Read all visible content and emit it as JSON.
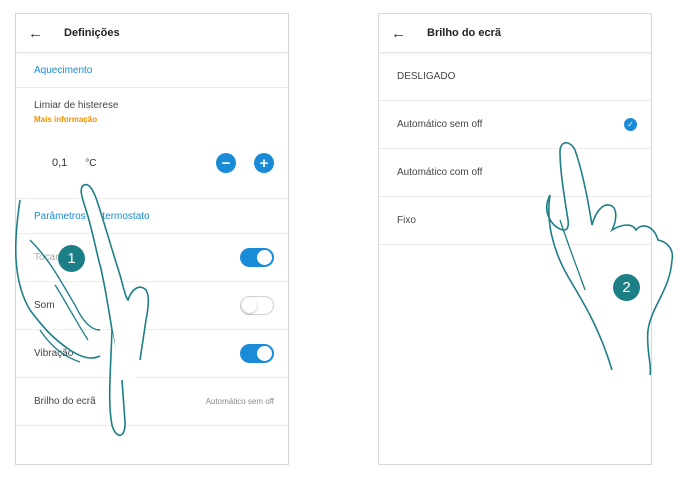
{
  "screen1": {
    "back_icon": "arrow-left-icon",
    "title": "Definições",
    "section_heating": "Aquecimento",
    "hysteresis_label": "Limiar de histerese",
    "more_info": "Mais informação",
    "value": "0,1",
    "unit": "°C",
    "minus_icon": "minus-icon",
    "plus_icon": "plus-icon",
    "section_thermostat": "Parâmetros do termostato",
    "touch_label": "Tocar",
    "touch_state": "on",
    "sound_label": "Som",
    "sound_state": "off",
    "vibration_label": "Vibração",
    "vibration_state": "on",
    "brightness_label": "Brilho do ecrã",
    "brightness_value": "Automático sem off"
  },
  "screen2": {
    "back_icon": "arrow-left-icon",
    "title": "Brilho do ecrã",
    "options": [
      {
        "label": "DESLIGADO",
        "selected": false
      },
      {
        "label": "Automático sem off",
        "selected": true
      },
      {
        "label": "Automático com off",
        "selected": false
      },
      {
        "label": "Fixo",
        "selected": false
      }
    ]
  },
  "steps": {
    "one": "1",
    "two": "2"
  },
  "colors": {
    "accent": "#1a8bd6",
    "link": "#f29100",
    "badge": "#1d7f86"
  }
}
